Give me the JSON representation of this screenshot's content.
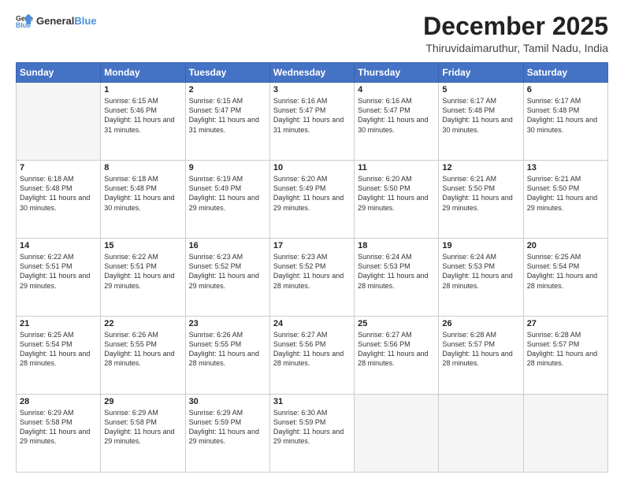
{
  "header": {
    "logo_general": "General",
    "logo_blue": "Blue",
    "title": "December 2025",
    "subtitle": "Thiruvidaimaruthur, Tamil Nadu, India"
  },
  "days_header": [
    "Sunday",
    "Monday",
    "Tuesday",
    "Wednesday",
    "Thursday",
    "Friday",
    "Saturday"
  ],
  "weeks": [
    [
      {
        "num": "",
        "sunrise": "",
        "sunset": "",
        "daylight": ""
      },
      {
        "num": "1",
        "sunrise": "Sunrise: 6:15 AM",
        "sunset": "Sunset: 5:46 PM",
        "daylight": "Daylight: 11 hours and 31 minutes."
      },
      {
        "num": "2",
        "sunrise": "Sunrise: 6:15 AM",
        "sunset": "Sunset: 5:47 PM",
        "daylight": "Daylight: 11 hours and 31 minutes."
      },
      {
        "num": "3",
        "sunrise": "Sunrise: 6:16 AM",
        "sunset": "Sunset: 5:47 PM",
        "daylight": "Daylight: 11 hours and 31 minutes."
      },
      {
        "num": "4",
        "sunrise": "Sunrise: 6:16 AM",
        "sunset": "Sunset: 5:47 PM",
        "daylight": "Daylight: 11 hours and 30 minutes."
      },
      {
        "num": "5",
        "sunrise": "Sunrise: 6:17 AM",
        "sunset": "Sunset: 5:48 PM",
        "daylight": "Daylight: 11 hours and 30 minutes."
      },
      {
        "num": "6",
        "sunrise": "Sunrise: 6:17 AM",
        "sunset": "Sunset: 5:48 PM",
        "daylight": "Daylight: 11 hours and 30 minutes."
      }
    ],
    [
      {
        "num": "7",
        "sunrise": "Sunrise: 6:18 AM",
        "sunset": "Sunset: 5:48 PM",
        "daylight": "Daylight: 11 hours and 30 minutes."
      },
      {
        "num": "8",
        "sunrise": "Sunrise: 6:18 AM",
        "sunset": "Sunset: 5:48 PM",
        "daylight": "Daylight: 11 hours and 30 minutes."
      },
      {
        "num": "9",
        "sunrise": "Sunrise: 6:19 AM",
        "sunset": "Sunset: 5:49 PM",
        "daylight": "Daylight: 11 hours and 29 minutes."
      },
      {
        "num": "10",
        "sunrise": "Sunrise: 6:20 AM",
        "sunset": "Sunset: 5:49 PM",
        "daylight": "Daylight: 11 hours and 29 minutes."
      },
      {
        "num": "11",
        "sunrise": "Sunrise: 6:20 AM",
        "sunset": "Sunset: 5:50 PM",
        "daylight": "Daylight: 11 hours and 29 minutes."
      },
      {
        "num": "12",
        "sunrise": "Sunrise: 6:21 AM",
        "sunset": "Sunset: 5:50 PM",
        "daylight": "Daylight: 11 hours and 29 minutes."
      },
      {
        "num": "13",
        "sunrise": "Sunrise: 6:21 AM",
        "sunset": "Sunset: 5:50 PM",
        "daylight": "Daylight: 11 hours and 29 minutes."
      }
    ],
    [
      {
        "num": "14",
        "sunrise": "Sunrise: 6:22 AM",
        "sunset": "Sunset: 5:51 PM",
        "daylight": "Daylight: 11 hours and 29 minutes."
      },
      {
        "num": "15",
        "sunrise": "Sunrise: 6:22 AM",
        "sunset": "Sunset: 5:51 PM",
        "daylight": "Daylight: 11 hours and 29 minutes."
      },
      {
        "num": "16",
        "sunrise": "Sunrise: 6:23 AM",
        "sunset": "Sunset: 5:52 PM",
        "daylight": "Daylight: 11 hours and 29 minutes."
      },
      {
        "num": "17",
        "sunrise": "Sunrise: 6:23 AM",
        "sunset": "Sunset: 5:52 PM",
        "daylight": "Daylight: 11 hours and 28 minutes."
      },
      {
        "num": "18",
        "sunrise": "Sunrise: 6:24 AM",
        "sunset": "Sunset: 5:53 PM",
        "daylight": "Daylight: 11 hours and 28 minutes."
      },
      {
        "num": "19",
        "sunrise": "Sunrise: 6:24 AM",
        "sunset": "Sunset: 5:53 PM",
        "daylight": "Daylight: 11 hours and 28 minutes."
      },
      {
        "num": "20",
        "sunrise": "Sunrise: 6:25 AM",
        "sunset": "Sunset: 5:54 PM",
        "daylight": "Daylight: 11 hours and 28 minutes."
      }
    ],
    [
      {
        "num": "21",
        "sunrise": "Sunrise: 6:25 AM",
        "sunset": "Sunset: 5:54 PM",
        "daylight": "Daylight: 11 hours and 28 minutes."
      },
      {
        "num": "22",
        "sunrise": "Sunrise: 6:26 AM",
        "sunset": "Sunset: 5:55 PM",
        "daylight": "Daylight: 11 hours and 28 minutes."
      },
      {
        "num": "23",
        "sunrise": "Sunrise: 6:26 AM",
        "sunset": "Sunset: 5:55 PM",
        "daylight": "Daylight: 11 hours and 28 minutes."
      },
      {
        "num": "24",
        "sunrise": "Sunrise: 6:27 AM",
        "sunset": "Sunset: 5:56 PM",
        "daylight": "Daylight: 11 hours and 28 minutes."
      },
      {
        "num": "25",
        "sunrise": "Sunrise: 6:27 AM",
        "sunset": "Sunset: 5:56 PM",
        "daylight": "Daylight: 11 hours and 28 minutes."
      },
      {
        "num": "26",
        "sunrise": "Sunrise: 6:28 AM",
        "sunset": "Sunset: 5:57 PM",
        "daylight": "Daylight: 11 hours and 28 minutes."
      },
      {
        "num": "27",
        "sunrise": "Sunrise: 6:28 AM",
        "sunset": "Sunset: 5:57 PM",
        "daylight": "Daylight: 11 hours and 28 minutes."
      }
    ],
    [
      {
        "num": "28",
        "sunrise": "Sunrise: 6:29 AM",
        "sunset": "Sunset: 5:58 PM",
        "daylight": "Daylight: 11 hours and 29 minutes."
      },
      {
        "num": "29",
        "sunrise": "Sunrise: 6:29 AM",
        "sunset": "Sunset: 5:58 PM",
        "daylight": "Daylight: 11 hours and 29 minutes."
      },
      {
        "num": "30",
        "sunrise": "Sunrise: 6:29 AM",
        "sunset": "Sunset: 5:59 PM",
        "daylight": "Daylight: 11 hours and 29 minutes."
      },
      {
        "num": "31",
        "sunrise": "Sunrise: 6:30 AM",
        "sunset": "Sunset: 5:59 PM",
        "daylight": "Daylight: 11 hours and 29 minutes."
      },
      {
        "num": "",
        "sunrise": "",
        "sunset": "",
        "daylight": ""
      },
      {
        "num": "",
        "sunrise": "",
        "sunset": "",
        "daylight": ""
      },
      {
        "num": "",
        "sunrise": "",
        "sunset": "",
        "daylight": ""
      }
    ]
  ]
}
